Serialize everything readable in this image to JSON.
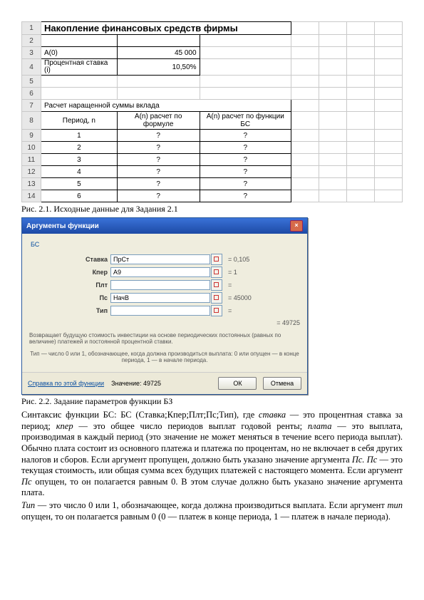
{
  "spreadsheet": {
    "title": "Накопление финансовых средств фирмы",
    "a0_label": "A(0)",
    "a0_value": "45 000",
    "rate_label": "Процентная ставка (i)",
    "rate_value": "10,50%",
    "calc_title": "Расчет наращенной суммы вклада",
    "hdr_period": "Период, n",
    "hdr_formula": "A(n) расчет по формуле",
    "hdr_fv": "A(n) расчет по функции БС",
    "rows": [
      {
        "n": "1",
        "f": "?",
        "fv": "?"
      },
      {
        "n": "2",
        "f": "?",
        "fv": "?"
      },
      {
        "n": "3",
        "f": "?",
        "fv": "?"
      },
      {
        "n": "4",
        "f": "?",
        "fv": "?"
      },
      {
        "n": "5",
        "f": "?",
        "fv": "?"
      },
      {
        "n": "6",
        "f": "?",
        "fv": "?"
      }
    ]
  },
  "caption1": "Рис. 2.1. Исходные данные для Задания 2.1",
  "dialog": {
    "title": "Аргументы функции",
    "fn": "БС",
    "args": [
      {
        "label": "Ставка",
        "value": "ПрСт",
        "result": "= 0,105"
      },
      {
        "label": "Кпер",
        "value": "A9",
        "result": "= 1"
      },
      {
        "label": "Плт",
        "value": "",
        "result": "="
      },
      {
        "label": "Пс",
        "value": "НачВ",
        "result": "= 45000"
      },
      {
        "label": "Тип",
        "value": "",
        "result": "="
      }
    ],
    "value_line": "= 49725",
    "desc1": "Возвращает будущую стоимость инвестиции на основе периодических постоянных (равных по величине) платежей и постоянной процентной ставки.",
    "desc2": "Тип — число 0 или 1, обозначающее, когда должна производиться выплата: 0 или опущен — в конце периода, 1 — в начале периода.",
    "result_label": "Значение:",
    "result_value": "49725",
    "help": "Справка по этой функции",
    "ok": "ОК",
    "cancel": "Отмена"
  },
  "caption2": "Рис. 2.2. Задание параметров функции БЗ",
  "para": {
    "p1_a": "Синтаксис функции БС: БС (Ставка;Кпер;Плт;Пс;Тип), где ",
    "p1_b": "ставка",
    "p1_c": " — это процентная ставка за период; ",
    "p1_d": "кпер",
    "p1_e": " — это общее число периодов выплат годовой ренты; ",
    "p1_f": "плата",
    "p1_g": " — это выплата, производимая в каждый период (это значение не может меняться в течение всего периода выплат). Обычно плата состоит из основного платежа и платежа по процентам, но не включает в себя других налогов и сборов. Если аргумент пропущен, должно быть указано значение аргумента ",
    "p1_h": "Пс. Пс",
    "p1_i": " — это текущая стоимость, или общая сумма всех будущих платежей с настоящего момента. Если аргумент ",
    "p1_j": "Пс",
    "p1_k": " опущен, то он полагается равным 0. В этом случае должно быть указано значение аргумента плата.",
    "p2_a": "Тип",
    "p2_b": " — это число 0 или 1, обозначающее, когда должна производиться выплата. Если аргумент ",
    "p2_c": "тип",
    "p2_d": " опущен, то он полагается равным 0 (0 — платеж в конце периода, 1 — платеж в начале периода)."
  }
}
